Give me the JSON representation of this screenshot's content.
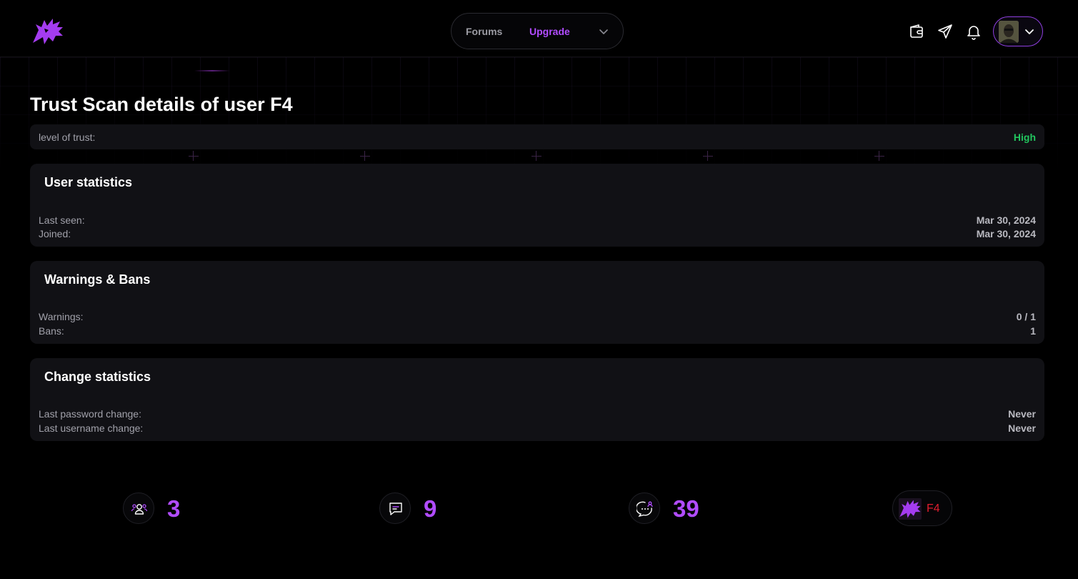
{
  "nav": {
    "forums": "Forums",
    "upgrade": "Upgrade"
  },
  "colors": {
    "accent": "#b14cff",
    "trust_high": "#22c55e",
    "username": "#e11d2e"
  },
  "icons": [
    "dragon-logo-icon",
    "chevron-down-icon",
    "wallet-icon",
    "send-icon",
    "bell-icon",
    "group-icon",
    "message-icon",
    "chat-icon"
  ],
  "page": {
    "title": "Trust Scan details of user F4"
  },
  "trust": {
    "label": "level of trust:",
    "value": "High"
  },
  "user_statistics": {
    "title": "User statistics",
    "rows": [
      {
        "label": "Last seen:",
        "value": "Mar 30, 2024"
      },
      {
        "label": "Joined:",
        "value": "Mar 30, 2024"
      }
    ]
  },
  "warnings_bans": {
    "title": "Warnings & Bans",
    "rows": [
      {
        "label": "Warnings:",
        "value": "0 / 1"
      },
      {
        "label": "Bans:",
        "value": "1"
      }
    ]
  },
  "change_statistics": {
    "title": "Change statistics",
    "rows": [
      {
        "label": "Last password change:",
        "value": "Never"
      },
      {
        "label": "Last username change:",
        "value": "Never"
      }
    ]
  },
  "stats": {
    "groups": "3",
    "messages": "9",
    "chats": "39"
  },
  "user": {
    "name": "F4"
  }
}
